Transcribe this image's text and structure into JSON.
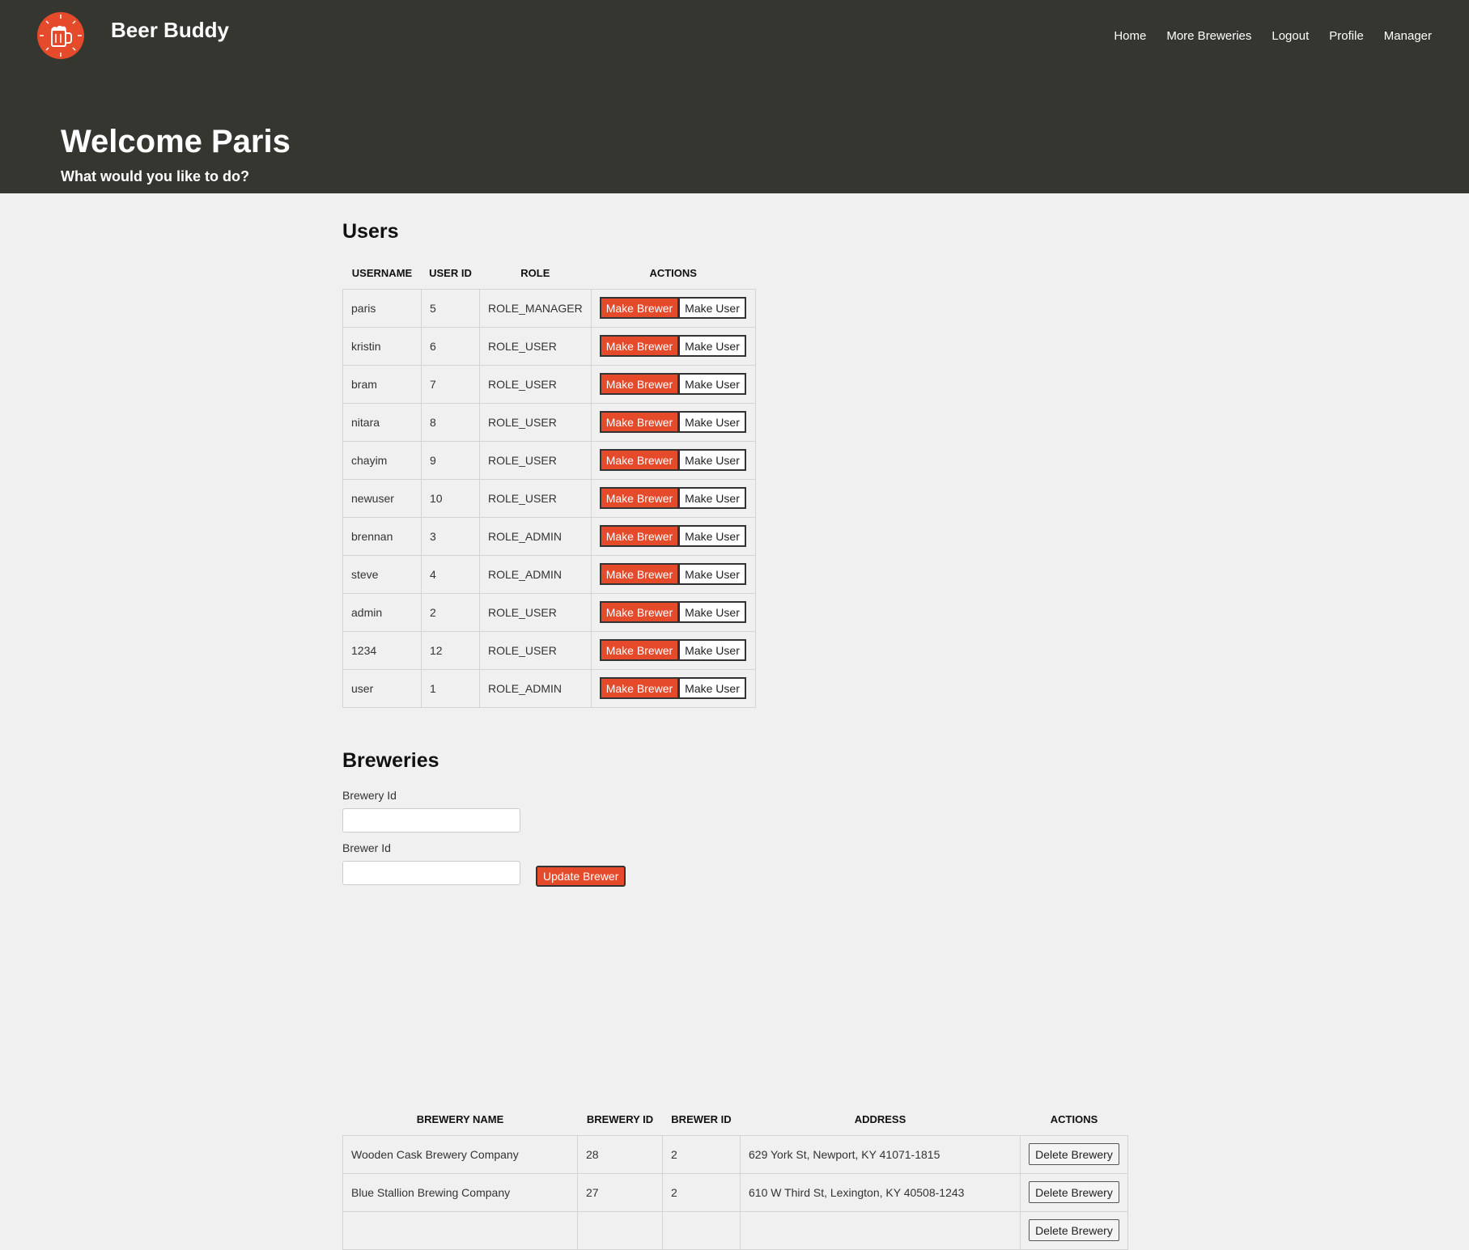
{
  "brand": {
    "name": "Beer Buddy",
    "logo_icon": "beer-mug-icon",
    "accent_color": "#e54a2b"
  },
  "nav": [
    {
      "label": "Home"
    },
    {
      "label": "More Breweries"
    },
    {
      "label": "Logout"
    },
    {
      "label": "Profile"
    },
    {
      "label": "Manager"
    }
  ],
  "hero": {
    "title": "Welcome Paris",
    "subtitle": "What would you like to do?"
  },
  "users": {
    "title": "Users",
    "columns": [
      "USERNAME",
      "USER ID",
      "ROLE",
      "ACTIONS"
    ],
    "make_brewer_label": "Make Brewer",
    "make_user_label": "Make User",
    "rows": [
      {
        "username": "paris",
        "id": "5",
        "role": "ROLE_MANAGER"
      },
      {
        "username": "kristin",
        "id": "6",
        "role": "ROLE_USER"
      },
      {
        "username": "bram",
        "id": "7",
        "role": "ROLE_USER"
      },
      {
        "username": "nitara",
        "id": "8",
        "role": "ROLE_USER"
      },
      {
        "username": "chayim",
        "id": "9",
        "role": "ROLE_USER"
      },
      {
        "username": "newuser",
        "id": "10",
        "role": "ROLE_USER"
      },
      {
        "username": "brennan",
        "id": "3",
        "role": "ROLE_ADMIN"
      },
      {
        "username": "steve",
        "id": "4",
        "role": "ROLE_ADMIN"
      },
      {
        "username": "admin",
        "id": "2",
        "role": "ROLE_USER"
      },
      {
        "username": "1234",
        "id": "12",
        "role": "ROLE_USER"
      },
      {
        "username": "user",
        "id": "1",
        "role": "ROLE_ADMIN"
      }
    ]
  },
  "breweries": {
    "title": "Breweries",
    "brewery_id_label": "Brewery Id",
    "brewery_id_value": "",
    "brewer_id_label": "Brewer Id",
    "brewer_id_value": "",
    "update_label": "Update Brewer",
    "columns": [
      "BREWERY NAME",
      "BREWERY ID",
      "BREWER ID",
      "ADDRESS",
      "ACTIONS"
    ],
    "delete_label": "Delete Brewery",
    "rows": [
      {
        "name": "Wooden Cask Brewery Company",
        "id": "28",
        "brewer_id": "2",
        "address": "629 York St, Newport, KY 41071-1815"
      },
      {
        "name": "Blue Stallion Brewing Company",
        "id": "27",
        "brewer_id": "2",
        "address": "610 W Third St, Lexington, KY 40508-1243"
      },
      {
        "name": "",
        "id": "",
        "brewer_id": "",
        "address": ""
      }
    ]
  }
}
